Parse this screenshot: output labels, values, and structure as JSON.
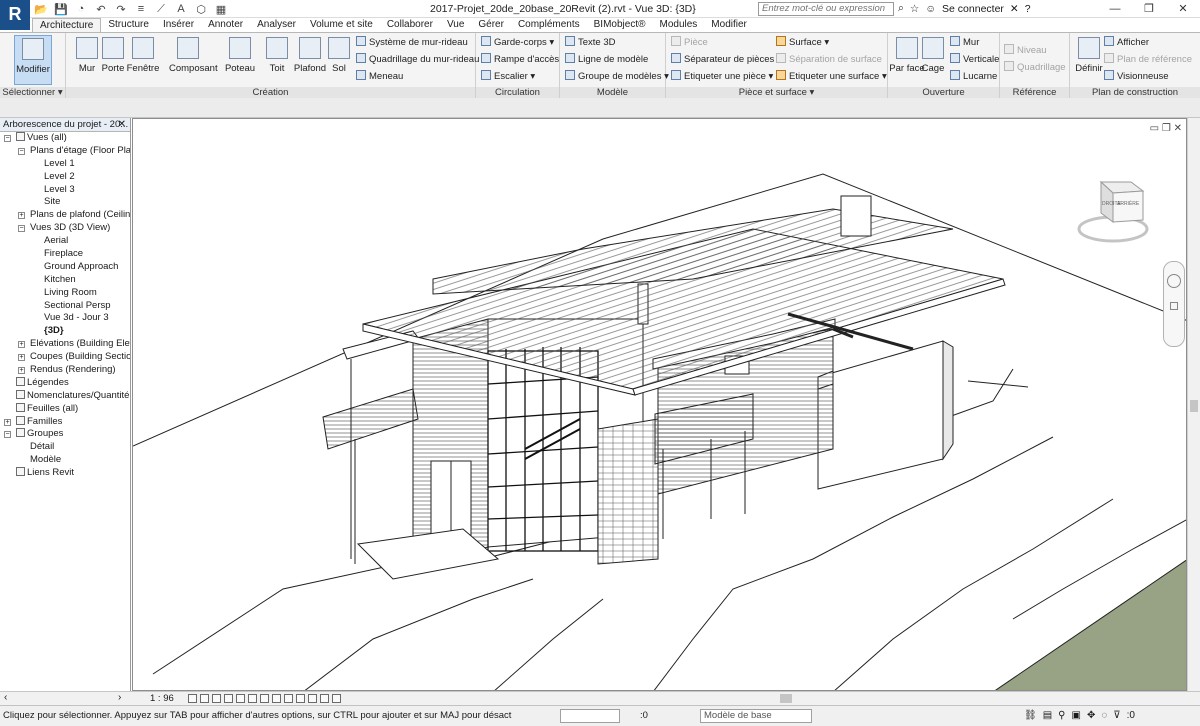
{
  "app": {
    "logo_letter": "R",
    "window_title": "2017-Projet_20de_20base_20Revit (2).rvt - Vue 3D: {3D}"
  },
  "quick_access": [
    "📂",
    "💾",
    "◔",
    "↶",
    "↷",
    "≡",
    "⟋",
    "A",
    "⬡",
    "▦"
  ],
  "title_bar": {
    "search_placeholder": "Entrez mot-clé ou expression",
    "sign_in": "Se connecter",
    "help": "?"
  },
  "window_controls": [
    "—",
    "❐",
    "✕"
  ],
  "ribbon_tabs": [
    {
      "label": "Architecture",
      "active": true
    },
    {
      "label": "Structure"
    },
    {
      "label": "Insérer"
    },
    {
      "label": "Annoter"
    },
    {
      "label": "Analyser"
    },
    {
      "label": "Volume et site"
    },
    {
      "label": "Collaborer"
    },
    {
      "label": "Vue"
    },
    {
      "label": "Gérer"
    },
    {
      "label": "Compléments"
    },
    {
      "label": "BIMobject®"
    },
    {
      "label": "Modules"
    },
    {
      "label": "Modifier"
    }
  ],
  "ribbon": {
    "select_panel": {
      "modify": "Modifier",
      "title": "Sélectionner ▾"
    },
    "creation": {
      "title": "Création",
      "big_buttons": [
        "Mur",
        "Porte",
        "Fenêtre",
        "Composant",
        "Poteau",
        "Toit",
        "Plafond",
        "Sol"
      ],
      "small_buttons": [
        "Système de mur-rideau",
        "Quadrillage du mur-rideau",
        "Meneau"
      ]
    },
    "circulation": {
      "title": "Circulation",
      "small_buttons": [
        "Garde-corps ▾",
        "Rampe d'accès",
        "Escalier ▾"
      ]
    },
    "modele": {
      "title": "Modèle",
      "small_buttons": [
        "Texte 3D",
        "Ligne de modèle",
        "Groupe de modèles ▾"
      ]
    },
    "piece_surface": {
      "title": "Pièce et surface ▾",
      "col1": [
        "Pièce",
        "Séparateur de pièces",
        "Etiqueter une pièce ▾"
      ],
      "col2": [
        "Surface ▾",
        "Séparation de surface",
        "Etiqueter une surface ▾"
      ]
    },
    "ouverture": {
      "title": "Ouverture",
      "big_buttons": [
        "Par face",
        "Cage"
      ],
      "small_buttons": [
        "Mur",
        "Verticale",
        "Lucarne"
      ]
    },
    "reference": {
      "title": "Référence",
      "small_buttons": [
        "Niveau",
        "Quadrillage"
      ]
    },
    "plan_construction": {
      "title": "Plan de construction",
      "big_button": "Définir",
      "small_buttons": [
        "Afficher",
        "Plan de référence",
        "Visionneuse"
      ]
    }
  },
  "browser": {
    "title": "Arborescence du projet - 20...",
    "close": "✕",
    "items": [
      {
        "label": "Vues (all)",
        "depth": 0,
        "toggle": "−",
        "icon": true
      },
      {
        "label": "Plans d'étage (Floor Plan",
        "depth": 1,
        "toggle": "−"
      },
      {
        "label": "Level 1",
        "depth": 2
      },
      {
        "label": "Level 2",
        "depth": 2
      },
      {
        "label": "Level 3",
        "depth": 2
      },
      {
        "label": "Site",
        "depth": 2
      },
      {
        "label": "Plans de plafond (Ceiling",
        "depth": 1,
        "toggle": "+"
      },
      {
        "label": "Vues 3D (3D View)",
        "depth": 1,
        "toggle": "−"
      },
      {
        "label": "Aerial",
        "depth": 2
      },
      {
        "label": "Fireplace",
        "depth": 2
      },
      {
        "label": "Ground Approach",
        "depth": 2
      },
      {
        "label": "Kitchen",
        "depth": 2
      },
      {
        "label": "Living Room",
        "depth": 2
      },
      {
        "label": "Sectional Persp",
        "depth": 2
      },
      {
        "label": "Vue 3d - Jour 3",
        "depth": 2
      },
      {
        "label": "{3D}",
        "depth": 2,
        "bold": true
      },
      {
        "label": "Elévations (Building Eleva",
        "depth": 1,
        "toggle": "+"
      },
      {
        "label": "Coupes (Building Section",
        "depth": 1,
        "toggle": "+"
      },
      {
        "label": "Rendus (Rendering)",
        "depth": 1,
        "toggle": "+"
      },
      {
        "label": "Légendes",
        "depth": 0,
        "icon": true
      },
      {
        "label": "Nomenclatures/Quantité",
        "depth": 0,
        "icon": true
      },
      {
        "label": "Feuilles (all)",
        "depth": 0,
        "icon": true
      },
      {
        "label": "Familles",
        "depth": 0,
        "toggle": "+",
        "icon": true
      },
      {
        "label": "Groupes",
        "depth": 0,
        "toggle": "−",
        "icon": true
      },
      {
        "label": "Détail",
        "depth": 1
      },
      {
        "label": "Modèle",
        "depth": 1
      },
      {
        "label": "Liens Revit",
        "depth": 0,
        "icon": true
      }
    ]
  },
  "view": {
    "controls": "▭ ❐ ✕",
    "viewcube_front": "DROITE",
    "viewcube_back": "ARRIÈRE"
  },
  "view_bar": {
    "scale": "1 : 96",
    "scroll_left": "‹",
    "scroll_right": "›"
  },
  "status": {
    "text": "Cliquez pour sélectionner. Appuyez sur TAB pour afficher d'autres options, sur CTRL pour ajouter et sur MAJ pour désact",
    "zero": ":0",
    "model": "Modèle de base",
    "filter": ":0"
  },
  "colors": {
    "brand": "#1b4f8a",
    "terrain": "#98a284",
    "active_tab": "#c6ddf3"
  }
}
